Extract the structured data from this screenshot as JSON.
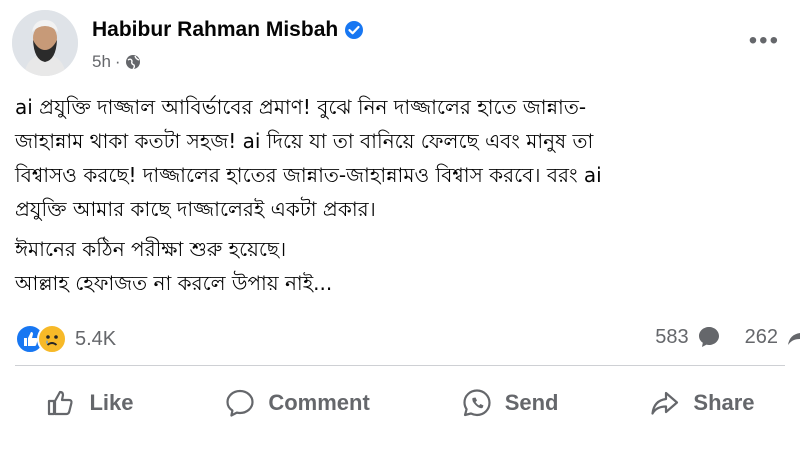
{
  "post": {
    "author": "Habibur Rahman Misbah",
    "time": "5h",
    "paragraph1": "ai প্রযুক্তি দাজ্জাল আবির্ভাবের প্রমাণ! বুঝে নিন দাজ্জালের হাতে জান্নাত-\nজাহান্নাম থাকা কতটা সহজ! ai দিয়ে যা তা বানিয়ে ফেলছে এবং মানুষ তা\nবিশ্বাসও করছে! দাজ্জালের হাতের জান্নাত-জাহান্নামও বিশ্বাস করবে। বরং ai\nপ্রযুক্তি আমার কাছে দাজ্জালেরই একটা প্রকার।",
    "paragraph2": "ঈমানের কঠিন পরীক্ষা শুরু হয়েছে।\nআল্লাহ হেফাজত না করলে উপায় নাই..."
  },
  "stats": {
    "reactions": "5.4K",
    "comments": "583",
    "shares": "262"
  },
  "actions": {
    "like": "Like",
    "comment": "Comment",
    "send": "Send",
    "share": "Share"
  },
  "colors": {
    "like_blue": "#1877f2",
    "sad_yellow": "#f7b928",
    "muted": "#65676b"
  },
  "icons": [
    "verified-icon",
    "globe-icon",
    "more-icon",
    "like-reaction-icon",
    "sad-reaction-icon",
    "comment-count-icon",
    "share-count-icon",
    "like-icon",
    "comment-icon",
    "send-icon",
    "share-icon"
  ]
}
